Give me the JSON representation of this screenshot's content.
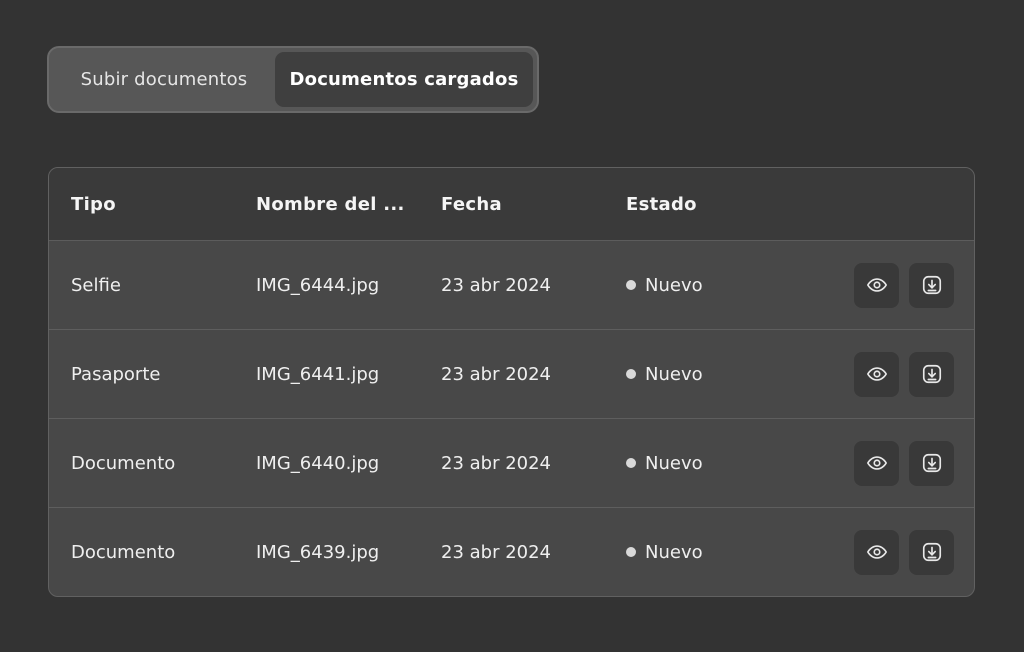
{
  "tabs": [
    {
      "label": "Subir documentos",
      "active": false
    },
    {
      "label": "Documentos cargados",
      "active": true
    }
  ],
  "table": {
    "headers": [
      "Tipo",
      "Nombre del ...",
      "Fecha",
      "Estado"
    ],
    "rows": [
      {
        "tipo": "Selfie",
        "nombre": "IMG_6444.jpg",
        "fecha": "23 abr 2024",
        "estado": "Nuevo"
      },
      {
        "tipo": "Pasaporte",
        "nombre": "IMG_6441.jpg",
        "fecha": "23 abr 2024",
        "estado": "Nuevo"
      },
      {
        "tipo": "Documento",
        "nombre": "IMG_6440.jpg",
        "fecha": "23 abr 2024",
        "estado": "Nuevo"
      },
      {
        "tipo": "Documento",
        "nombre": "IMG_6439.jpg",
        "fecha": "23 abr 2024",
        "estado": "Nuevo"
      }
    ],
    "row_actions": [
      "eye-icon",
      "download-icon"
    ]
  },
  "colors": {
    "background": "#333333",
    "status_dot": "#d9d9d9"
  }
}
